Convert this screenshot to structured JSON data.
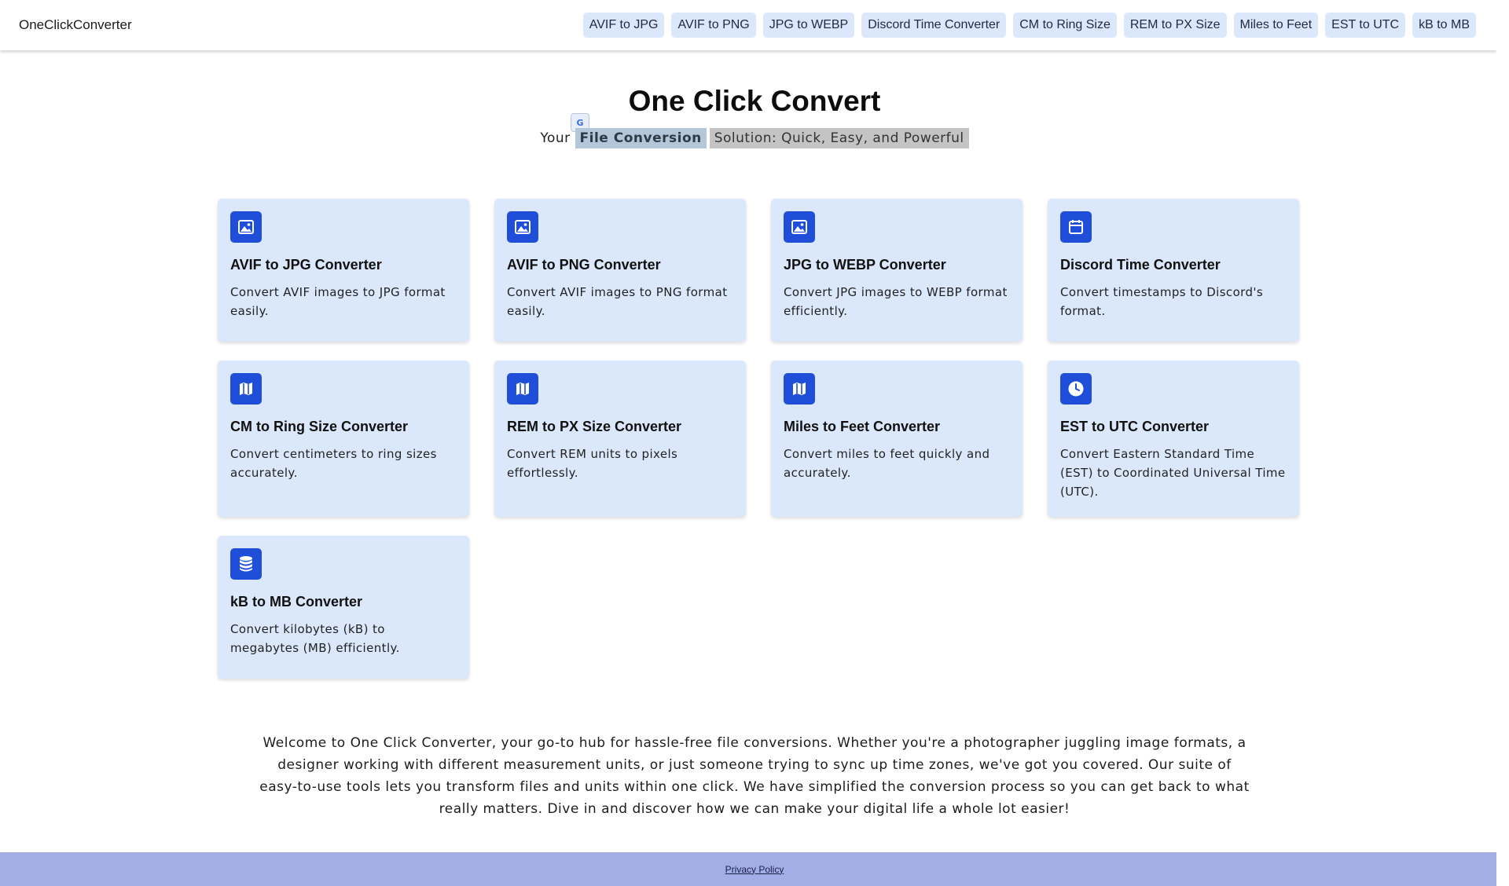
{
  "header": {
    "brand": "OneClickConverter",
    "nav": [
      "AVIF to JPG",
      "AVIF to PNG",
      "JPG to WEBP",
      "Discord Time Converter",
      "CM to Ring Size",
      "REM to PX Size",
      "Miles to Feet",
      "EST to UTC",
      "kB to MB"
    ]
  },
  "hero": {
    "title": "One Click Convert",
    "subtitle_prefix": "Your",
    "subtitle_highlight": "File Conversion",
    "subtitle_rest": "Solution: Quick, Easy, and Powerful",
    "translate_icon": "G"
  },
  "cards": [
    {
      "icon": "image-icon",
      "title": "AVIF to JPG Converter",
      "desc": "Convert AVIF images to JPG format easily."
    },
    {
      "icon": "image-icon",
      "title": "AVIF to PNG Converter",
      "desc": "Convert AVIF images to PNG format easily."
    },
    {
      "icon": "image-icon",
      "title": "JPG to WEBP Converter",
      "desc": "Convert JPG images to WEBP format efficiently."
    },
    {
      "icon": "calendar-icon",
      "title": "Discord Time Converter",
      "desc": "Convert timestamps to Discord's format."
    },
    {
      "icon": "map-icon",
      "title": "CM to Ring Size Converter",
      "desc": "Convert centimeters to ring sizes accurately."
    },
    {
      "icon": "map-icon",
      "title": "REM to PX Size Converter",
      "desc": "Convert REM units to pixels effortlessly."
    },
    {
      "icon": "map-icon",
      "title": "Miles to Feet Converter",
      "desc": "Convert miles to feet quickly and accurately."
    },
    {
      "icon": "clock-icon",
      "title": "EST to UTC Converter",
      "desc": "Convert Eastern Standard Time (EST) to Coordinated Universal Time (UTC)."
    },
    {
      "icon": "database-icon",
      "title": "kB to MB Converter",
      "desc": "Convert kilobytes (kB) to megabytes (MB) efficiently."
    }
  ],
  "intro": "Welcome to One Click Converter, your go-to hub for hassle-free file conversions. Whether you're a photographer juggling image formats, a designer working with different measurement units, or just someone trying to sync up time zones, we've got you covered. Our suite of easy-to-use tools lets you transform files and units within one click. We have simplified the conversion process so you can get back to what really matters. Dive in and discover how we can make your digital life a whole lot easier!",
  "footer": {
    "privacy": "Privacy Policy"
  },
  "colors": {
    "accent": "#1f4fd8",
    "card_bg": "#dbe8fb",
    "footer_bg": "#a3ade6"
  }
}
